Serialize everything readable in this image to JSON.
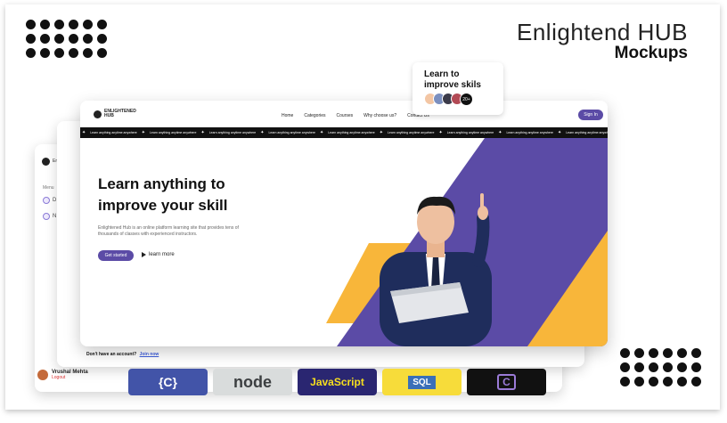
{
  "brand": {
    "title": "Enlightend HUB",
    "subtitle": "Mockups"
  },
  "nav": {
    "logo": "ENLIGHTENED HUB",
    "links": [
      "Home",
      "Categories",
      "Courses",
      "Why choose us?",
      "Contact Us"
    ],
    "signin": "Sign In"
  },
  "ticker": {
    "text": "Learn anything anytime anywhere"
  },
  "hero": {
    "headline": "Learn anything to improve your skill",
    "paragraph": "Enlightened Hub is an online platform learning site that provides tens of thousands of classes with experienced instructors.",
    "start_label": "Get started",
    "learn_label": "learn more"
  },
  "card": {
    "title": "Learn to improve skils",
    "count": "20+"
  },
  "back_screen": {
    "logo": "Enlig Hub",
    "menu_label": "Menu",
    "items": [
      "D",
      "N"
    ],
    "user_name": "Vrushal Mehta",
    "logout": "Logout"
  },
  "signup": {
    "text": "Don't have an account?",
    "link": "Join now"
  },
  "tiles": [
    {
      "label": "{C}",
      "bg": "#4254a8",
      "fg": "#ffffff"
    },
    {
      "label": "node",
      "bg": "#d9dcdc",
      "fg": "#3c3f41"
    },
    {
      "label": "JavaScript",
      "bg": "#2a2671",
      "fg": "#f7df1e"
    },
    {
      "label": "SQL",
      "bg": "#f7dc3a",
      "fg": "#ffffff"
    },
    {
      "label": "C",
      "bg": "#111111",
      "fg": "#9b7bd8"
    }
  ],
  "colors": {
    "accent": "#5b4ba6",
    "yellow": "#f8b63a",
    "dark": "#111111"
  }
}
